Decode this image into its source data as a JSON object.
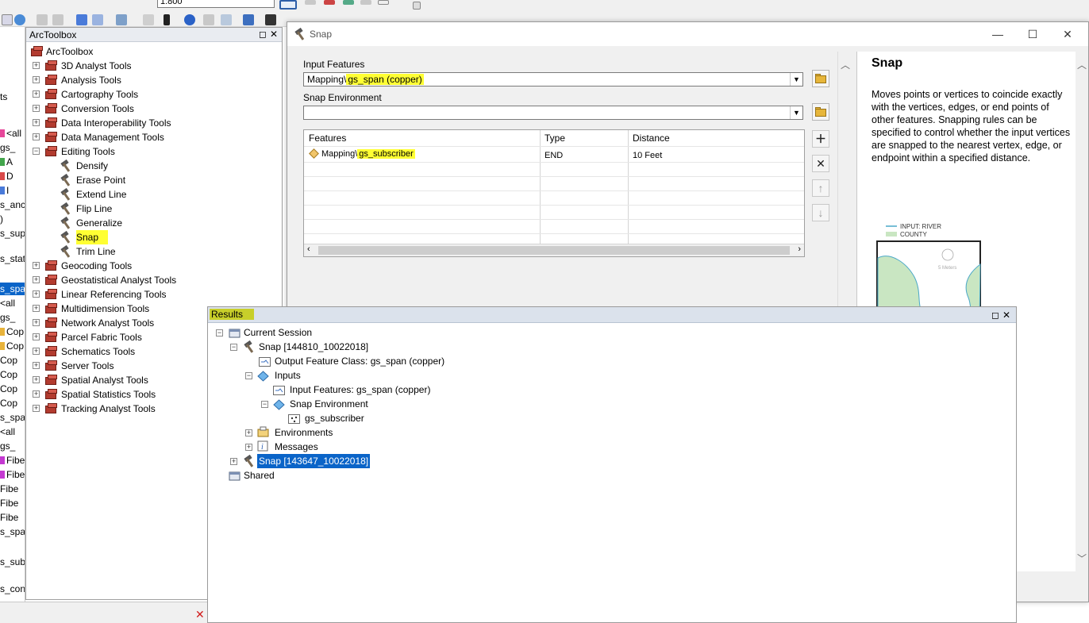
{
  "toolbar": {
    "scale": "1:800"
  },
  "left_strip": {
    "items": [
      {
        "text": "ts",
        "mark": ""
      },
      {
        "text": "<all",
        "mark": "#e6479a"
      },
      {
        "text": "gs_",
        "mark": ""
      },
      {
        "text": "A",
        "mark": "#42a54b"
      },
      {
        "text": "D",
        "mark": "#d94a4a"
      },
      {
        "text": "I",
        "mark": "#4a7bd9"
      },
      {
        "text": "s_anc",
        "mark": ""
      },
      {
        "text": ")",
        "mark": ""
      },
      {
        "text": "s_sup",
        "mark": ""
      },
      {
        "text": "s_stat",
        "mark": ""
      },
      {
        "text": "s_spa",
        "mark": ""
      },
      {
        "text": "<all",
        "mark": ""
      },
      {
        "text": "gs_",
        "mark": ""
      },
      {
        "text": "Cop",
        "mark": "#e8b33b"
      },
      {
        "text": "Cop",
        "mark": "#e8b33b"
      },
      {
        "text": "Cop",
        "mark": ""
      },
      {
        "text": "Cop",
        "mark": ""
      },
      {
        "text": "Cop",
        "mark": ""
      },
      {
        "text": "Cop",
        "mark": ""
      },
      {
        "text": "s_spa",
        "mark": ""
      },
      {
        "text": "<all",
        "mark": ""
      },
      {
        "text": "gs_",
        "mark": ""
      },
      {
        "text": "Fibe",
        "mark": "#c43ad1"
      },
      {
        "text": "Fibe",
        "mark": "#c43ad1"
      },
      {
        "text": "Fibe",
        "mark": ""
      },
      {
        "text": "Fibe",
        "mark": ""
      },
      {
        "text": "Fibe",
        "mark": ""
      },
      {
        "text": "s_spa",
        "mark": ""
      },
      {
        "text": "s_sub",
        "mark": ""
      },
      {
        "text": "s_conduit",
        "mark": ""
      }
    ]
  },
  "toolbox": {
    "title": "ArcToolbox",
    "root": "ArcToolbox",
    "toolsets": [
      "3D Analyst Tools",
      "Analysis Tools",
      "Cartography Tools",
      "Conversion Tools",
      "Data Interoperability Tools",
      "Data Management Tools",
      "Editing Tools"
    ],
    "editing_tools": [
      "Densify",
      "Erase Point",
      "Extend Line",
      "Flip Line",
      "Generalize",
      "Snap",
      "Trim Line"
    ],
    "toolsets_after": [
      "Geocoding Tools",
      "Geostatistical Analyst Tools",
      "Linear Referencing Tools",
      "Multidimension Tools",
      "Network Analyst Tools",
      "Parcel Fabric Tools",
      "Schematics Tools",
      "Server Tools",
      "Spatial Analyst Tools",
      "Spatial Statistics Tools",
      "Tracking Analyst Tools"
    ]
  },
  "snap_dialog": {
    "title": "Snap",
    "input_features_label": "Input Features",
    "input_features_prefix": "Mapping\\",
    "input_features_value": "gs_span (copper)",
    "snap_env_label": "Snap Environment",
    "snap_env_value": "",
    "grid": {
      "columns": [
        "Features",
        "Type",
        "Distance"
      ],
      "row_prefix": "Mapping\\",
      "row_feature": "gs_subscriber",
      "row_type": "END",
      "row_distance": "10 Feet"
    },
    "help": {
      "title": "Snap",
      "text": "Moves points or vertices to coincide exactly with the vertices, edges, or end points of other features. Snapping rules can be specified to control whether the input vertices are snapped to the nearest vertex, edge, or endpoint within a specified distance.",
      "legend_river": "INPUT: RIVER",
      "legend_county": "COUNTY",
      "distance_label": "5 Meters"
    }
  },
  "results": {
    "title": "Results",
    "current_session": "Current Session",
    "snap1": "Snap [144810_10022018]",
    "output_fc": "Output Feature Class: gs_span (copper)",
    "inputs": "Inputs",
    "input_features": "Input Features: gs_span (copper)",
    "snap_env": "Snap Environment",
    "gs_subscriber": "gs_subscriber",
    "environments": "Environments",
    "messages": "Messages",
    "snap2": "Snap [143647_10022018]",
    "shared": "Shared"
  }
}
